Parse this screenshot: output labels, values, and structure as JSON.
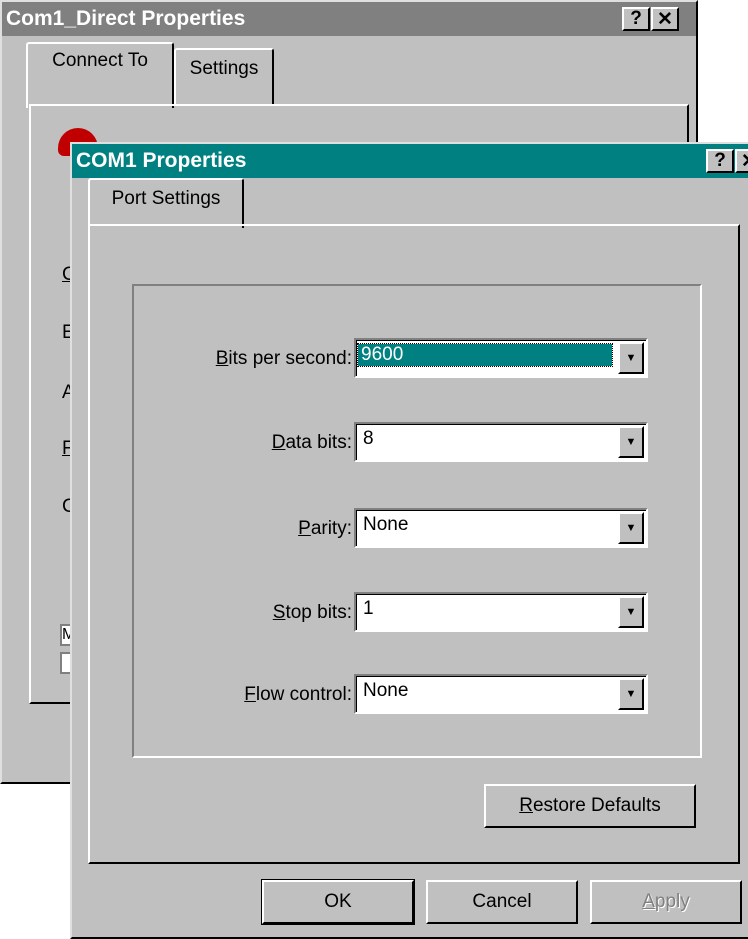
{
  "back_window": {
    "title": "Com1_Direct Properties",
    "help_label": "?",
    "close_label": "✕",
    "tabs": [
      {
        "label": "Connect To",
        "active": true
      },
      {
        "label": "Settings",
        "active": false
      }
    ],
    "partial_letters": [
      "C",
      "E",
      "A",
      "F",
      "C"
    ],
    "checkbox_letters": [
      "M",
      ""
    ]
  },
  "front_window": {
    "title": "COM1 Properties",
    "help_label": "?",
    "close_label": "✕",
    "tab": "Port Settings",
    "fields": [
      {
        "mnemonic": "B",
        "rest": "its per second:",
        "value": "9600",
        "selected": true
      },
      {
        "mnemonic": "D",
        "rest": "ata bits:",
        "value": "8",
        "selected": false
      },
      {
        "mnemonic": "P",
        "rest": "arity:",
        "value": "None",
        "selected": false
      },
      {
        "mnemonic": "S",
        "rest": "top bits:",
        "value": "1",
        "selected": false
      },
      {
        "mnemonic": "F",
        "rest": "low control:",
        "value": "None",
        "selected": false
      }
    ],
    "restore": {
      "mnemonic": "R",
      "rest": "estore Defaults"
    },
    "ok": "OK",
    "cancel": "Cancel",
    "apply": {
      "mnemonic": "A",
      "rest": "pply",
      "enabled": false
    }
  },
  "colors": {
    "active_title": "#008080",
    "inactive_title": "#808080",
    "face": "#c0c0c0",
    "selection": "#008080"
  }
}
